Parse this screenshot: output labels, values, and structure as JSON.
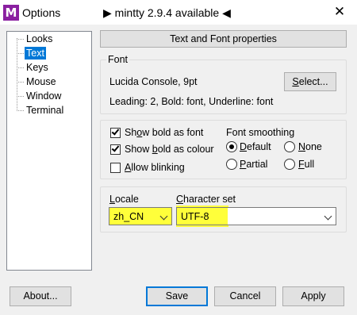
{
  "titlebar": {
    "app_icon": "M",
    "title": "Options",
    "update_notice": "▶ mintty 2.9.4 available ◀",
    "close_glyph": "✕"
  },
  "tree": {
    "items": [
      {
        "label": "Looks",
        "selected": false
      },
      {
        "label": "Text",
        "selected": true
      },
      {
        "label": "Keys",
        "selected": false
      },
      {
        "label": "Mouse",
        "selected": false
      },
      {
        "label": "Window",
        "selected": false
      },
      {
        "label": "Terminal",
        "selected": false
      }
    ]
  },
  "page": {
    "header": "Text and Font properties",
    "font_group": {
      "title": "Font",
      "font_name": "Lucida Console, 9pt",
      "select_button": "Select...",
      "details": "Leading: 2, Bold: font, Underline: font"
    },
    "options": {
      "show_bold_as_font": {
        "label": "Show bold as font",
        "checked": true
      },
      "show_bold_as_colour": {
        "label": "Show bold as colour",
        "checked": true
      },
      "allow_blinking": {
        "label": "Allow blinking",
        "checked": false
      }
    },
    "smoothing": {
      "title": "Font smoothing",
      "options": [
        {
          "label": "Default",
          "selected": true
        },
        {
          "label": "None",
          "selected": false
        },
        {
          "label": "Partial",
          "selected": false
        },
        {
          "label": "Full",
          "selected": false
        }
      ]
    },
    "locale": {
      "label": "Locale",
      "value": "zh_CN"
    },
    "charset": {
      "label": "Character set",
      "value": "UTF-8"
    }
  },
  "buttons": {
    "about": "About...",
    "save": "Save",
    "cancel": "Cancel",
    "apply": "Apply"
  },
  "colors": {
    "highlight": "#ffff3a",
    "selection": "#0078d7",
    "app_icon_bg": "#8a1fa0"
  }
}
